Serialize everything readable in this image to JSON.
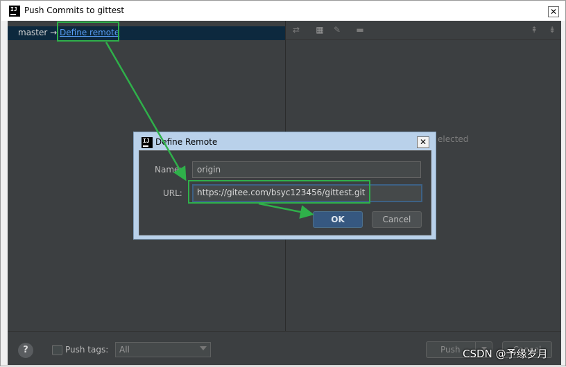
{
  "window": {
    "title": "Push Commits to gittest",
    "close": "✕"
  },
  "left": {
    "branch": "master",
    "arrow": "→",
    "define_remote": "Define remote"
  },
  "right": {
    "no_selection": "elected"
  },
  "bottom": {
    "help": "?",
    "push_tags_label": "Push tags:",
    "tags_value": "All",
    "push_label": "Push",
    "cancel_label": "Cancel"
  },
  "dialog": {
    "title": "Define Remote",
    "close": "✕",
    "name_label": "Name:",
    "name_value": "origin",
    "url_label": "URL:",
    "url_value": "https://gitee.com/bsyc123456/gittest.git",
    "ok_label": "OK",
    "cancel_label": "Cancel"
  },
  "watermark": "CSDN @予缘岁月",
  "colors": {
    "annotation": "#2fb04a",
    "accent": "#365880",
    "link": "#589df6"
  }
}
